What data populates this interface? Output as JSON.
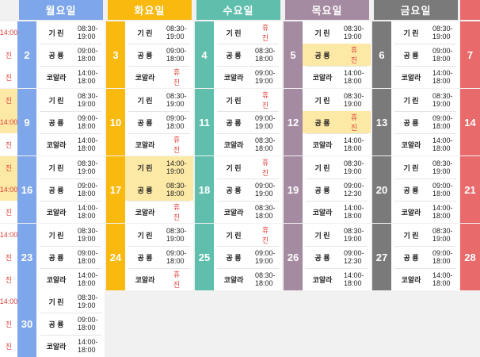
{
  "headers": [
    "월요일",
    "화요일",
    "수요일",
    "목요일",
    "금요일"
  ],
  "colors": {
    "mon": "#7ea6ea",
    "tue": "#f9b90f",
    "wed": "#5fbfac",
    "thu": "#a58ba2",
    "fri": "#7a7a7a",
    "sat": "#e86a6a",
    "sun_text": "#e0403a",
    "highlight": "#fde9a6"
  },
  "weeks": [
    {
      "sun": [
        "14:00",
        "진",
        "진"
      ],
      "sun_hl": [
        false,
        false,
        false
      ],
      "days": [
        {
          "num": "2",
          "rows": [
            {
              "name": "기 린",
              "time": "08:30-19:00"
            },
            {
              "name": "공 룡",
              "time": "09:00-18:00"
            },
            {
              "name": "코알라",
              "time": "14:00-18:00"
            }
          ]
        },
        {
          "num": "3",
          "rows": [
            {
              "name": "기 린",
              "time": "08:30-19:00"
            },
            {
              "name": "공 룡",
              "time": "09:00-18:00"
            },
            {
              "name": "코알라",
              "time": "휴 진",
              "closed": true
            }
          ]
        },
        {
          "num": "4",
          "rows": [
            {
              "name": "기 린",
              "time": "휴 진",
              "closed": true
            },
            {
              "name": "공 룡",
              "time": "08:30-18:00"
            },
            {
              "name": "코알라",
              "time": "09:00-19:00"
            }
          ]
        },
        {
          "num": "5",
          "rows": [
            {
              "name": "기 린",
              "time": "08:30-19:00"
            },
            {
              "name": "공 룡",
              "time": "휴 진",
              "closed": true,
              "hl": true
            },
            {
              "name": "코알라",
              "time": "14:00-18:00"
            }
          ]
        },
        {
          "num": "6",
          "rows": [
            {
              "name": "기 린",
              "time": "08:30-19:00"
            },
            {
              "name": "공 룡",
              "time": "09:00-18:00"
            },
            {
              "name": "코알라",
              "time": "14:00-18:00"
            }
          ]
        }
      ],
      "sat": "7"
    },
    {
      "sun": [
        "진",
        "14:00",
        "진"
      ],
      "sun_hl": [
        true,
        true,
        false
      ],
      "days": [
        {
          "num": "9",
          "rows": [
            {
              "name": "기 린",
              "time": "08:30-19:00"
            },
            {
              "name": "공 룡",
              "time": "09:00-18:00"
            },
            {
              "name": "코알라",
              "time": "14:00-18:00"
            }
          ]
        },
        {
          "num": "10",
          "rows": [
            {
              "name": "기 린",
              "time": "08:30-19:00"
            },
            {
              "name": "공 룡",
              "time": "09:00-18:00"
            },
            {
              "name": "코알라",
              "time": "휴 진",
              "closed": true
            }
          ]
        },
        {
          "num": "11",
          "rows": [
            {
              "name": "기 린",
              "time": "휴 진",
              "closed": true
            },
            {
              "name": "공 룡",
              "time": "09:00-19:00"
            },
            {
              "name": "코알라",
              "time": "08:30-18:00"
            }
          ]
        },
        {
          "num": "12",
          "rows": [
            {
              "name": "기 린",
              "time": "08:30-19:00"
            },
            {
              "name": "공 룡",
              "time": "휴 진",
              "closed": true,
              "hl": true
            },
            {
              "name": "코알라",
              "time": "14:00-18:00"
            }
          ]
        },
        {
          "num": "13",
          "rows": [
            {
              "name": "기 린",
              "time": "08:30-19:00"
            },
            {
              "name": "공 룡",
              "time": "09:00-18:00"
            },
            {
              "name": "코알라",
              "time": "14:00-18:00"
            }
          ]
        }
      ],
      "sat": "14"
    },
    {
      "sun": [
        "진",
        "14:00",
        "진"
      ],
      "sun_hl": [
        true,
        true,
        false
      ],
      "days": [
        {
          "num": "16",
          "rows": [
            {
              "name": "기 린",
              "time": "08:30-19:00"
            },
            {
              "name": "공 룡",
              "time": "09:00-18:00"
            },
            {
              "name": "코알라",
              "time": "14:00-18:00"
            }
          ]
        },
        {
          "num": "17",
          "rows": [
            {
              "name": "기 린",
              "time": "14:00-19:00",
              "hl": true
            },
            {
              "name": "공 룡",
              "time": "08:30-18:00",
              "hl": true
            },
            {
              "name": "코알라",
              "time": "휴 진",
              "closed": true
            }
          ]
        },
        {
          "num": "18",
          "rows": [
            {
              "name": "기 린",
              "time": "휴 진",
              "closed": true
            },
            {
              "name": "공 룡",
              "time": "09:00-19:00"
            },
            {
              "name": "코알라",
              "time": "08:30-18:00"
            }
          ]
        },
        {
          "num": "19",
          "rows": [
            {
              "name": "기 린",
              "time": "08:30-19:00"
            },
            {
              "name": "공 룡",
              "time": "09:00-12:30"
            },
            {
              "name": "코알라",
              "time": "14:00-18:00"
            }
          ]
        },
        {
          "num": "20",
          "rows": [
            {
              "name": "기 린",
              "time": "08:30-19:00"
            },
            {
              "name": "공 룡",
              "time": "09:00-18:00"
            },
            {
              "name": "코알라",
              "time": "14:00-18:00"
            }
          ]
        }
      ],
      "sat": "21"
    },
    {
      "sun": [
        "14:00",
        "진",
        "진"
      ],
      "sun_hl": [
        false,
        false,
        false
      ],
      "days": [
        {
          "num": "23",
          "rows": [
            {
              "name": "기 린",
              "time": "08:30-19:00"
            },
            {
              "name": "공 룡",
              "time": "09:00-18:00"
            },
            {
              "name": "코알라",
              "time": "14:00-18:00"
            }
          ]
        },
        {
          "num": "24",
          "rows": [
            {
              "name": "기 린",
              "time": "08:30-19:00"
            },
            {
              "name": "공 룡",
              "time": "09:00-18:00"
            },
            {
              "name": "코알라",
              "time": "휴 진",
              "closed": true
            }
          ]
        },
        {
          "num": "25",
          "rows": [
            {
              "name": "기 린",
              "time": "휴 진",
              "closed": true
            },
            {
              "name": "공 룡",
              "time": "09:00-19:00"
            },
            {
              "name": "코알라",
              "time": "08:30-18:00"
            }
          ]
        },
        {
          "num": "26",
          "rows": [
            {
              "name": "기 린",
              "time": "08:30-19:00"
            },
            {
              "name": "공 룡",
              "time": "09:00-12:30"
            },
            {
              "name": "코알라",
              "time": "14:00-18:00"
            }
          ]
        },
        {
          "num": "27",
          "rows": [
            {
              "name": "기 린",
              "time": "08:30-19:00"
            },
            {
              "name": "공 룡",
              "time": "09:00-18:00"
            },
            {
              "name": "코알라",
              "time": "14:00-18:00"
            }
          ]
        }
      ],
      "sat": "28"
    },
    {
      "sun": [
        "14:00",
        "진",
        "진"
      ],
      "sun_hl": [
        false,
        false,
        false
      ],
      "days": [
        {
          "num": "30",
          "rows": [
            {
              "name": "기 린",
              "time": "08:30-19:00"
            },
            {
              "name": "공 룡",
              "time": "09:00-18:00"
            },
            {
              "name": "코알라",
              "time": "14:00-18:00"
            }
          ]
        }
      ],
      "sat": ""
    }
  ]
}
